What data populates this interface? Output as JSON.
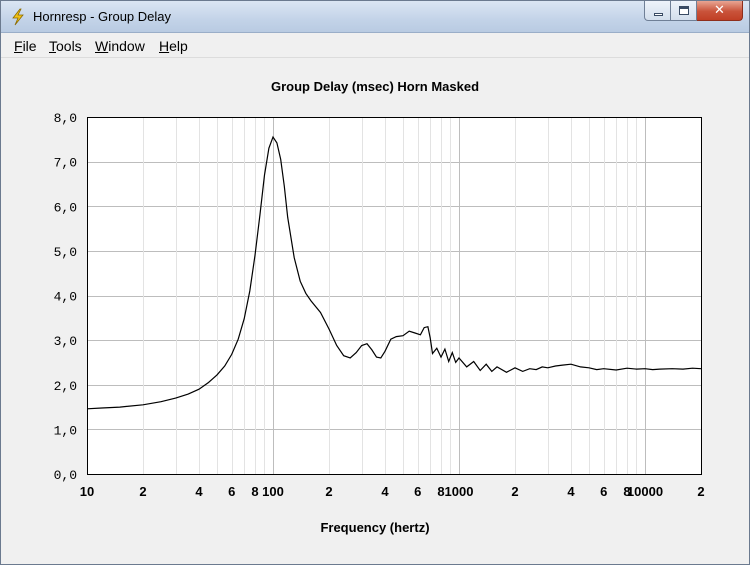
{
  "window": {
    "title": "Hornresp - Group Delay",
    "app_icon": "lightning-icon",
    "buttons": {
      "minimize": "minimize-icon",
      "maximize": "maximize-icon",
      "close": "close-icon"
    }
  },
  "menu": [
    {
      "label": "File"
    },
    {
      "label": "Tools"
    },
    {
      "label": "Window"
    },
    {
      "label": "Help"
    }
  ],
  "chart_data": {
    "type": "line",
    "title": "Group Delay (msec)   Horn   Masked",
    "xlabel": "Frequency (hertz)",
    "ylabel": "",
    "x_scale": "log",
    "xlim": [
      10,
      20000
    ],
    "ylim": [
      0,
      8
    ],
    "y_tick_labels": [
      "0,0",
      "1,0",
      "2,0",
      "3,0",
      "4,0",
      "5,0",
      "6,0",
      "7,0",
      "8,0"
    ],
    "x_tick_labels": [
      {
        "x": 10,
        "label": "10"
      },
      {
        "x": 20,
        "label": "2"
      },
      {
        "x": 40,
        "label": "4"
      },
      {
        "x": 60,
        "label": "6"
      },
      {
        "x": 80,
        "label": "8"
      },
      {
        "x": 100,
        "label": "100"
      },
      {
        "x": 200,
        "label": "2"
      },
      {
        "x": 400,
        "label": "4"
      },
      {
        "x": 600,
        "label": "6"
      },
      {
        "x": 800,
        "label": "8"
      },
      {
        "x": 1000,
        "label": "1000"
      },
      {
        "x": 2000,
        "label": "2"
      },
      {
        "x": 4000,
        "label": "4"
      },
      {
        "x": 6000,
        "label": "6"
      },
      {
        "x": 8000,
        "label": "8"
      },
      {
        "x": 10000,
        "label": "10000"
      },
      {
        "x": 20000,
        "label": "2"
      }
    ],
    "grid": true,
    "colors": {
      "line": "#000000",
      "grid_minor": "#e3e3e3",
      "grid_major": "#bdbdbd",
      "plot_bg": "#ffffff"
    },
    "series": [
      {
        "x": [
          10,
          12,
          15,
          20,
          25,
          30,
          35,
          40,
          45,
          50,
          55,
          60,
          65,
          70,
          75,
          80,
          85,
          90,
          95,
          100,
          105,
          110,
          115,
          120,
          130,
          140,
          150,
          160,
          180,
          200,
          220,
          240,
          260,
          280,
          300,
          320,
          340,
          360,
          380,
          400,
          430,
          460,
          500,
          540,
          580,
          620,
          650,
          680,
          700,
          720,
          760,
          800,
          840,
          880,
          920,
          960,
          1000,
          1100,
          1200,
          1300,
          1400,
          1500,
          1600,
          1800,
          2000,
          2200,
          2400,
          2600,
          2800,
          3000,
          3300,
          3600,
          4000,
          4500,
          5000,
          5500,
          6000,
          7000,
          8000,
          9000,
          10000,
          11000,
          12000,
          14000,
          16000,
          18000,
          20000
        ],
        "y": [
          1.46,
          1.48,
          1.5,
          1.55,
          1.62,
          1.7,
          1.79,
          1.9,
          2.05,
          2.22,
          2.42,
          2.68,
          3.02,
          3.48,
          4.1,
          4.9,
          5.8,
          6.7,
          7.3,
          7.55,
          7.42,
          7.05,
          6.45,
          5.75,
          4.85,
          4.32,
          4.05,
          3.88,
          3.62,
          3.25,
          2.88,
          2.65,
          2.6,
          2.72,
          2.88,
          2.92,
          2.78,
          2.62,
          2.6,
          2.75,
          3.02,
          3.08,
          3.1,
          3.2,
          3.16,
          3.12,
          3.28,
          3.3,
          3.05,
          2.7,
          2.82,
          2.62,
          2.8,
          2.52,
          2.72,
          2.5,
          2.6,
          2.4,
          2.52,
          2.32,
          2.46,
          2.3,
          2.4,
          2.28,
          2.38,
          2.3,
          2.36,
          2.34,
          2.4,
          2.38,
          2.42,
          2.44,
          2.46,
          2.4,
          2.38,
          2.34,
          2.36,
          2.33,
          2.37,
          2.35,
          2.36,
          2.34,
          2.35,
          2.36,
          2.35,
          2.37,
          2.36
        ]
      }
    ]
  }
}
